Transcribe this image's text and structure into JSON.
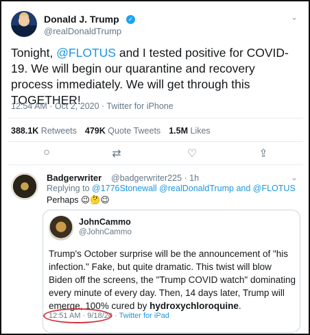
{
  "tweet": {
    "author_name": "Donald J. Trump",
    "author_handle": "@realDonaldTrump",
    "verified_glyph": "✓",
    "text_part1": "Tonight, ",
    "mention": "@FLOTUS",
    "text_part2": " and I tested positive for COVID-19. We will begin our quarantine and recovery process immediately. We will get through this TOGETHER!",
    "meta": "12:54 AM · Oct 2, 2020 · Twitter for iPhone",
    "stats": {
      "retweets_count": "388.1K",
      "retweets_label": "Retweets",
      "quote_count": "479K",
      "quote_label": "Quote Tweets",
      "likes_count": "1.5M",
      "likes_label": "Likes"
    },
    "actions": {
      "reply_icon": "○",
      "retweet_icon": "⇄",
      "like_icon": "♡",
      "share_icon": "⇪"
    },
    "menu_glyph": "⌄"
  },
  "reply": {
    "author_name": "Badgerwriter",
    "author_handle": "@badgerwriter225 · 1h",
    "replying_label": "Replying to ",
    "replying_mentions": "@1776Stonewall @realDonaldTrump and @FLOTUS",
    "text": "Perhaps 😉🤔😉",
    "menu_glyph": "⌄",
    "quote": {
      "author_name": "JohnCammo",
      "author_handle": "@JohnCammo",
      "text_main": "Trump's October surprise will be the announcement of \"his infection.\" Fake, but quite dramatic. This twist will blow Biden off the screens, the \"Trump COVID watch\" dominating every minute of every day. Then, 14 days later, Trump will emerge, 100% cured by ",
      "text_bold": "hydroxychloroquine",
      "text_end": ".",
      "meta_time": "12:51 AM · 9/18/20 · ",
      "meta_source": "Twitter for iPad"
    }
  },
  "colors": {
    "accent": "#1b95e0",
    "verified": "#1da1f2",
    "muted": "#657786",
    "highlight_oval": "#d0303a"
  }
}
